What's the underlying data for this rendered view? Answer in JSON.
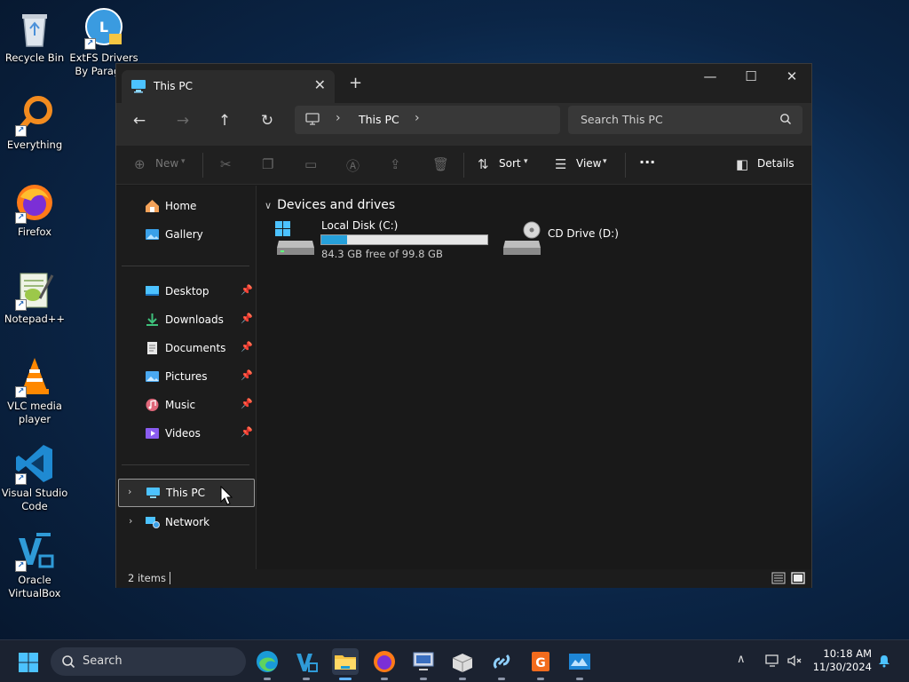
{
  "desktop": {
    "icons": [
      {
        "label": "Recycle Bin",
        "icon": "recycle-bin-icon",
        "shortcut": false
      },
      {
        "label": "ExtFS Drivers By Paragon",
        "icon": "extfs-drivers-icon",
        "shortcut": true
      },
      {
        "label": "Everything",
        "icon": "everything-search-icon",
        "shortcut": true
      },
      {
        "label": "Firefox",
        "icon": "firefox-icon",
        "shortcut": true
      },
      {
        "label": "Notepad++",
        "icon": "notepadpp-icon",
        "shortcut": true
      },
      {
        "label": "VLC media player",
        "icon": "vlc-icon",
        "shortcut": true
      },
      {
        "label": "Visual Studio Code",
        "icon": "vscode-icon",
        "shortcut": true
      },
      {
        "label": "Oracle VirtualBox",
        "icon": "virtualbox-icon",
        "shortcut": true
      }
    ]
  },
  "window": {
    "tab_title": "This PC",
    "tab_close": "✕",
    "new_tab": "+",
    "controls": {
      "minimize": "—",
      "maximize": "☐",
      "close": "✕"
    },
    "address": {
      "crumb": "This PC",
      "separator": "›"
    },
    "search_placeholder": "Search This PC",
    "commands": {
      "new_label": "New",
      "sort_label": "Sort",
      "view_label": "View",
      "more_label": "···",
      "details_label": "Details"
    },
    "nav": {
      "home": "Home",
      "gallery": "Gallery",
      "pinned": [
        {
          "label": "Desktop",
          "icon": "desktop-folder-icon"
        },
        {
          "label": "Downloads",
          "icon": "downloads-folder-icon"
        },
        {
          "label": "Documents",
          "icon": "documents-folder-icon"
        },
        {
          "label": "Pictures",
          "icon": "pictures-folder-icon"
        },
        {
          "label": "Music",
          "icon": "music-folder-icon"
        },
        {
          "label": "Videos",
          "icon": "videos-folder-icon"
        }
      ],
      "this_pc": "This PC",
      "network": "Network"
    },
    "content": {
      "group_title": "Devices and drives",
      "drives": [
        {
          "name": "Local Disk (C:)",
          "free_text": "84.3 GB free of 99.8 GB",
          "used_fraction": 0.155
        },
        {
          "name": "CD Drive (D:)"
        }
      ]
    },
    "status": {
      "item_count": "2 items"
    }
  },
  "taskbar": {
    "search_placeholder": "Search",
    "apps": [
      "edge-icon",
      "virtualbox-taskbar-icon",
      "file-explorer-icon",
      "firefox-taskbar-icon",
      "virtual-machine-icon",
      "package-icon",
      "link-tool-icon",
      "presentation-app-icon",
      "monitor-app-icon"
    ],
    "time": "10:18 AM",
    "date": "11/30/2024"
  },
  "colors": {
    "accent": "#26a0da",
    "window_bg": "#191919",
    "taskbar_bg": "#1b2230"
  }
}
